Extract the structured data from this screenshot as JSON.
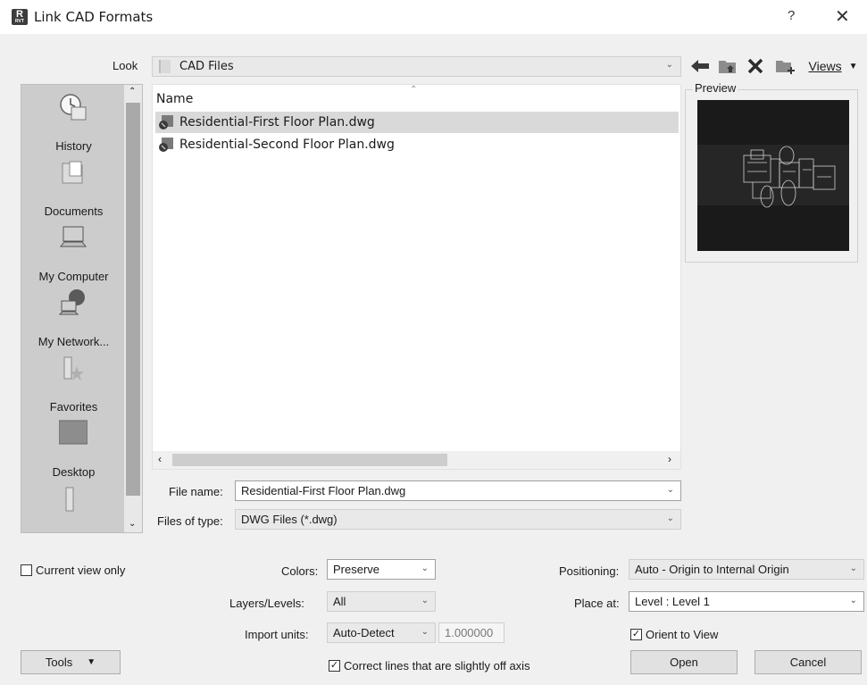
{
  "window": {
    "title": "Link CAD Formats",
    "help_glyph": "?",
    "close_glyph": "✕",
    "app_icon_letter": "R",
    "app_icon_sub": "RVT"
  },
  "look": {
    "label": "Look",
    "value": "CAD Files"
  },
  "toolbar": {
    "back_icon": "back-arrow-icon",
    "up_folder_icon": "up-folder-icon",
    "delete_icon": "delete-icon",
    "new_folder_icon": "new-folder-icon",
    "views_label": "Views",
    "views_accel": "V",
    "views_rest": "iews"
  },
  "places": [
    {
      "label": "History",
      "icon": "history-icon"
    },
    {
      "label": "Documents",
      "icon": "documents-icon"
    },
    {
      "label": "My Computer",
      "icon": "computer-icon"
    },
    {
      "label": "My Network...",
      "icon": "network-icon"
    },
    {
      "label": "Favorites",
      "icon": "favorites-icon"
    },
    {
      "label": "Desktop",
      "icon": "desktop-icon"
    }
  ],
  "file_list": {
    "column_name": "Name",
    "files": [
      {
        "name": "Residential-First Floor Plan.dwg",
        "selected": true
      },
      {
        "name": "Residential-Second Floor Plan.dwg",
        "selected": false
      }
    ]
  },
  "preview": {
    "label": "Preview"
  },
  "file_name": {
    "label": "File name:",
    "value": "Residential-First Floor Plan.dwg"
  },
  "files_of_type": {
    "label": "Files of type:",
    "value": "DWG Files  (*.dwg)"
  },
  "options": {
    "current_view_only": {
      "label": "Current view only",
      "checked": false
    },
    "colors": {
      "label": "Colors:",
      "value": "Preserve"
    },
    "layers": {
      "label": "Layers/Levels:",
      "value": "All"
    },
    "import_units": {
      "label": "Import units:",
      "value": "Auto-Detect",
      "factor": "1.000000"
    },
    "correct_lines": {
      "label": "Correct lines that are slightly off axis",
      "checked": true
    },
    "positioning": {
      "label": "Positioning:",
      "value": "Auto - Origin to Internal Origin"
    },
    "place_at": {
      "label": "Place at:",
      "value": "Level : Level 1"
    },
    "orient_to_view": {
      "label": "Orient to View",
      "checked": true
    }
  },
  "buttons": {
    "tools_label": "Tools",
    "open_label": "Open",
    "cancel_label": "Cancel"
  },
  "colors": {
    "dialog_bg": "#f0f0f0",
    "places_bg": "#cccccc",
    "selection": "#d9d9d9",
    "preview_bg": "#1a1a1a"
  }
}
